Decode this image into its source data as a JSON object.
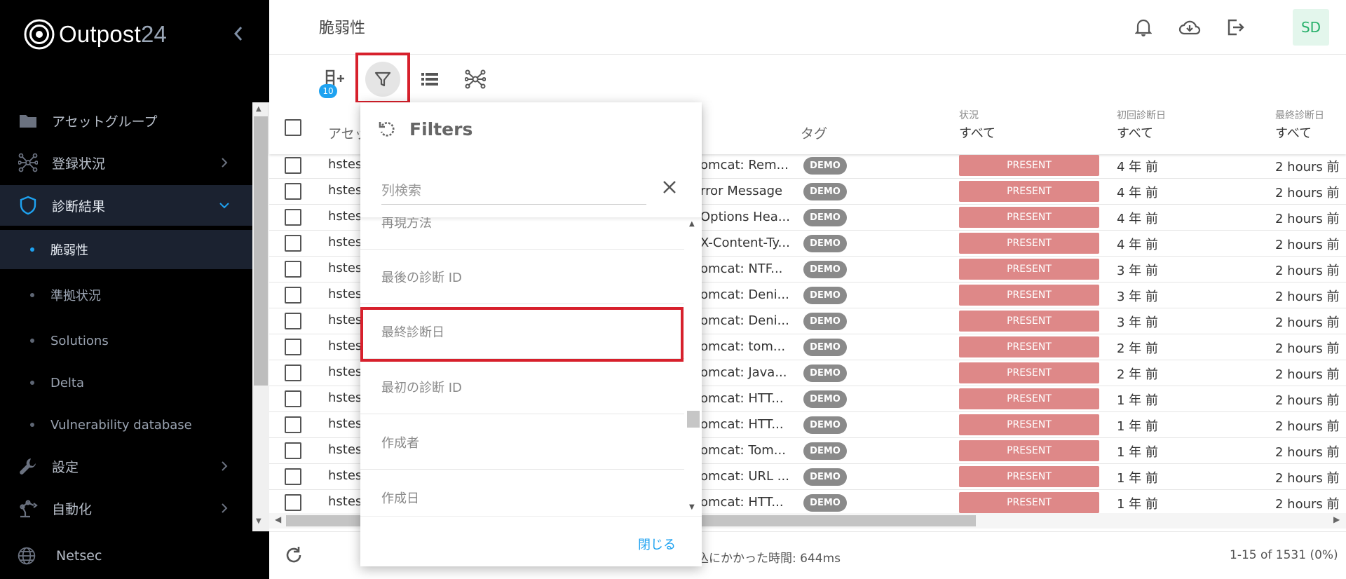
{
  "app": {
    "brand_main": "Outpost",
    "brand_num": "24"
  },
  "sidebar": {
    "items": [
      {
        "label": "アセットグループ",
        "icon": "folder-icon"
      },
      {
        "label": "登録状況",
        "icon": "network-icon"
      },
      {
        "label": "診断結果",
        "icon": "shield-icon"
      },
      {
        "label": "設定",
        "icon": "wrench-icon"
      },
      {
        "label": "自動化",
        "icon": "robot-arm-icon"
      },
      {
        "label": "Netsec",
        "icon": "globe-icon"
      }
    ],
    "sub_items": [
      {
        "label": "脆弱性"
      },
      {
        "label": "準拠状況"
      },
      {
        "label": "Solutions"
      },
      {
        "label": "Delta"
      },
      {
        "label": "Vulnerability database"
      }
    ]
  },
  "header": {
    "title": "脆弱性",
    "avatar": "SD"
  },
  "toolbar": {
    "badge": "10"
  },
  "table": {
    "headers": {
      "asset": "アセッ",
      "tag": "タグ",
      "status_small": "状況",
      "status_val": "すべて",
      "first_small": "初回診断日",
      "first_val": "すべて",
      "last_small": "最終診断日",
      "last_val": "すべて"
    },
    "rows": [
      {
        "asset": "hstes",
        "name": "omcat: Rem...",
        "tag": "DEMO",
        "status": "PRESENT",
        "first": "4 年 前",
        "last": "2 hours 前"
      },
      {
        "asset": "hstes",
        "name": "rror Message",
        "tag": "DEMO",
        "status": "PRESENT",
        "first": "4 年 前",
        "last": "2 hours 前"
      },
      {
        "asset": "hstes",
        "name": "Options Hea...",
        "tag": "DEMO",
        "status": "PRESENT",
        "first": "4 年 前",
        "last": "2 hours 前"
      },
      {
        "asset": "hstes",
        "name": "X-Content-Ty...",
        "tag": "DEMO",
        "status": "PRESENT",
        "first": "4 年 前",
        "last": "2 hours 前"
      },
      {
        "asset": "hstes",
        "name": "omcat: NTF...",
        "tag": "DEMO",
        "status": "PRESENT",
        "first": "3 年 前",
        "last": "2 hours 前"
      },
      {
        "asset": "hstes",
        "name": "omcat: Deni...",
        "tag": "DEMO",
        "status": "PRESENT",
        "first": "3 年 前",
        "last": "2 hours 前"
      },
      {
        "asset": "hstes",
        "name": "omcat: Deni...",
        "tag": "DEMO",
        "status": "PRESENT",
        "first": "3 年 前",
        "last": "2 hours 前"
      },
      {
        "asset": "hstes",
        "name": "omcat: tom...",
        "tag": "DEMO",
        "status": "PRESENT",
        "first": "2 年 前",
        "last": "2 hours 前"
      },
      {
        "asset": "hstes",
        "name": "omcat: Java...",
        "tag": "DEMO",
        "status": "PRESENT",
        "first": "2 年 前",
        "last": "2 hours 前"
      },
      {
        "asset": "hstes",
        "name": "omcat: HTT...",
        "tag": "DEMO",
        "status": "PRESENT",
        "first": "1 年 前",
        "last": "2 hours 前"
      },
      {
        "asset": "hstes",
        "name": "omcat: HTT...",
        "tag": "DEMO",
        "status": "PRESENT",
        "first": "1 年 前",
        "last": "2 hours 前"
      },
      {
        "asset": "hstes",
        "name": "omcat: Tom...",
        "tag": "DEMO",
        "status": "PRESENT",
        "first": "1 年 前",
        "last": "2 hours 前"
      },
      {
        "asset": "hstes",
        "name": "omcat: URL ...",
        "tag": "DEMO",
        "status": "PRESENT",
        "first": "1 年 前",
        "last": "2 hours 前"
      },
      {
        "asset": "hstes",
        "name": "omcat: HTT...",
        "tag": "DEMO",
        "status": "PRESENT",
        "first": "1 年 前",
        "last": "2 hours 前"
      }
    ]
  },
  "footer": {
    "time": "込にかかった時間: 644ms",
    "paging": "1-15 of 1531 (0%)"
  },
  "filters": {
    "title": "Filters",
    "search_placeholder": "列検索",
    "items": [
      "再現方法",
      "最後の診断 ID",
      "最終診断日",
      "最初の診断 ID",
      "作成者",
      "作成日"
    ],
    "close": "閉じる"
  },
  "colors": {
    "accent": "#1ea2f0",
    "present": "#de8888",
    "highlight": "#d7202c",
    "avatar_text": "#27b06a"
  }
}
